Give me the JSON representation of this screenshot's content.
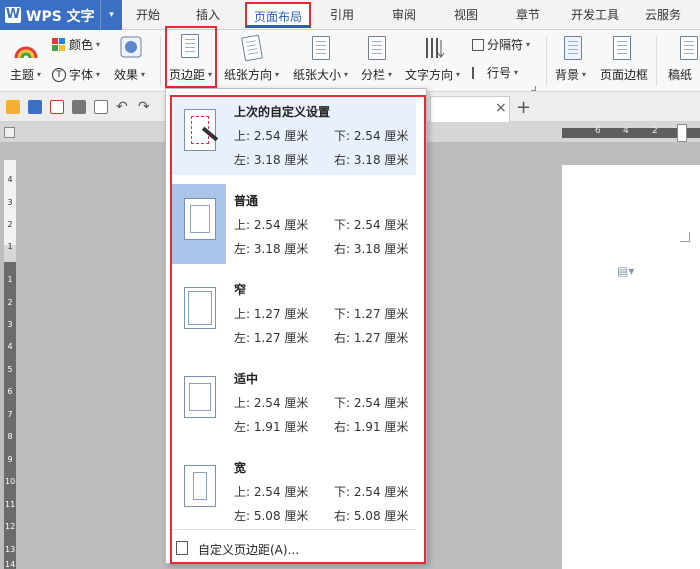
{
  "app": {
    "logo": "W",
    "name": "WPS 文字",
    "dropdown_glyph": "▾"
  },
  "menu": {
    "items": [
      "开始",
      "插入",
      "页面布局",
      "引用",
      "审阅",
      "视图",
      "章节",
      "开发工具",
      "云服务"
    ],
    "active": "页面布局"
  },
  "ribbon": {
    "theme": "主题",
    "color": "颜色",
    "font": "字体",
    "effect": "效果",
    "margins": "页边距",
    "orientation": "纸张方向",
    "size": "纸张大小",
    "columns": "分栏",
    "text_direction": "文字方向",
    "breaks": "分隔符",
    "line_numbers": "行号",
    "background": "背景",
    "page_border": "页面边框",
    "manuscript": "稿纸"
  },
  "tabs": {
    "close_glyph": "×",
    "add_glyph": "+"
  },
  "ruler": {
    "top_numbers": [
      "6",
      "4",
      "2"
    ],
    "side_numbers": [
      "4",
      "3",
      "2",
      "1",
      "1",
      "2",
      "3",
      "4",
      "5",
      "6",
      "7",
      "8",
      "9",
      "10",
      "11",
      "12",
      "13",
      "14"
    ]
  },
  "margin_presets": [
    {
      "title": "上次的自定义设置",
      "top": "上: 2.54 厘米",
      "bottom": "下: 2.54 厘米",
      "left": "左: 3.18 厘米",
      "right": "右: 3.18 厘米",
      "icon": "edit-icon"
    },
    {
      "title": "普通",
      "top": "上: 2.54 厘米",
      "bottom": "下: 2.54 厘米",
      "left": "左: 3.18 厘米",
      "right": "右: 3.18 厘米",
      "icon": "page-margin-icon"
    },
    {
      "title": "窄",
      "top": "上: 1.27 厘米",
      "bottom": "下: 1.27 厘米",
      "left": "左: 1.27 厘米",
      "right": "右: 1.27 厘米",
      "icon": "page-margin-icon"
    },
    {
      "title": "适中",
      "top": "上: 2.54 厘米",
      "bottom": "下: 2.54 厘米",
      "left": "左: 1.91 厘米",
      "right": "右: 1.91 厘米",
      "icon": "page-margin-icon"
    },
    {
      "title": "宽",
      "top": "上: 2.54 厘米",
      "bottom": "下: 2.54 厘米",
      "left": "左: 5.08 厘米",
      "right": "右: 5.08 厘米",
      "icon": "page-margin-icon"
    }
  ],
  "custom_margins": "自定义页边距(A)...",
  "colors": {
    "accent": "#3a6fc3",
    "highlight": "#e32d35",
    "selected_bg": "#e8f0fb"
  }
}
